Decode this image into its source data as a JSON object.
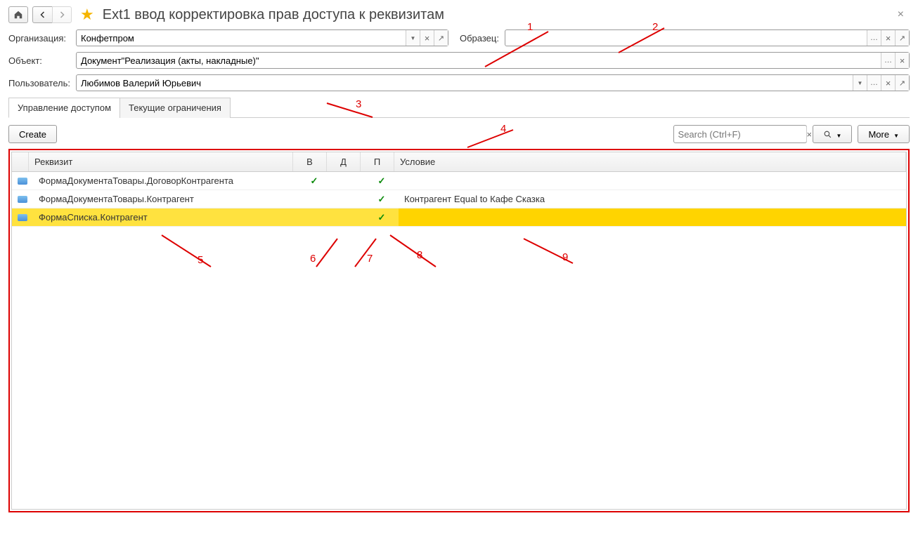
{
  "header": {
    "title": "Ext1 ввод корректировка прав доступа к реквизитам"
  },
  "form": {
    "org_label": "Организация:",
    "org_value": "Конфетпром",
    "sample_label": "Образец:",
    "sample_value": "",
    "object_label": "Объект:",
    "object_value": "Документ\"Реализация (акты, накладные)\"",
    "user_label": "Пользователь:",
    "user_value": "Любимов Валерий Юрьевич"
  },
  "tabs": {
    "tab1": "Управление доступом",
    "tab2": "Текущие ограничения"
  },
  "toolbar": {
    "create": "Create",
    "search_placeholder": "Search (Ctrl+F)",
    "more": "More"
  },
  "grid": {
    "headers": {
      "rekvizit": "Реквизит",
      "v": "В",
      "d": "Д",
      "p": "П",
      "uslovie": "Условие"
    },
    "rows": [
      {
        "name": "ФормаДокументаТовары.ДоговорКонтрагента",
        "v": "✓",
        "d": "",
        "p": "✓",
        "cond": ""
      },
      {
        "name": "ФормаДокументаТовары.Контрагент",
        "v": "",
        "d": "",
        "p": "✓",
        "cond": "Контрагент Equal to Кафе Сказка"
      },
      {
        "name": "ФормаСписка.Контрагент",
        "v": "",
        "d": "",
        "p": "✓",
        "cond": ""
      }
    ]
  },
  "annotations": {
    "n1": "1",
    "n2": "2",
    "n3": "3",
    "n4": "4",
    "n5": "5",
    "n6": "6",
    "n7": "7",
    "n8": "8",
    "n9": "9"
  }
}
